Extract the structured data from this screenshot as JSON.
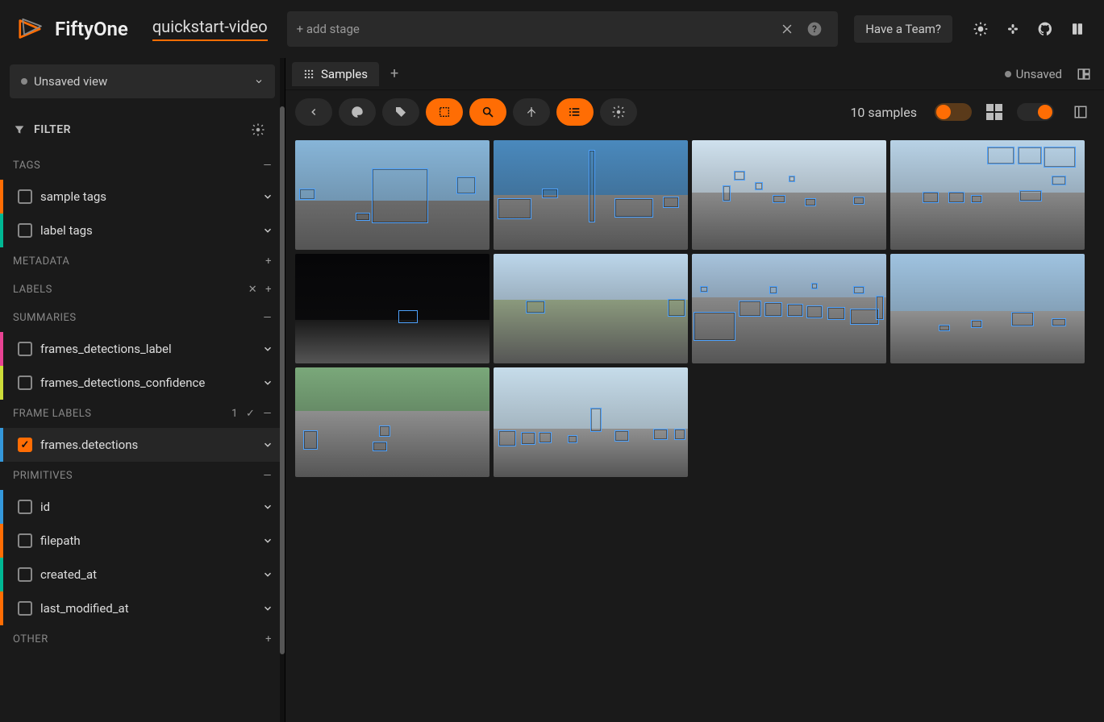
{
  "header": {
    "brand": "FiftyOne",
    "dataset": "quickstart-video",
    "add_stage_placeholder": "+ add stage",
    "team_button": "Have a Team?"
  },
  "sidebar": {
    "view_selector": "Unsaved view",
    "filter_label": "FILTER",
    "sections": [
      {
        "title": "TAGS",
        "action": "minus"
      },
      {
        "title": "METADATA",
        "action": "plus"
      },
      {
        "title": "LABELS",
        "action": "x-plus"
      },
      {
        "title": "SUMMARIES",
        "action": "minus"
      },
      {
        "title": "FRAME LABELS",
        "action": "count-minus",
        "count": "1"
      },
      {
        "title": "PRIMITIVES",
        "action": "minus"
      },
      {
        "title": "OTHER",
        "action": "plus"
      }
    ],
    "items": {
      "tags": [
        {
          "label": "sample tags",
          "color": "orange",
          "checked": false
        },
        {
          "label": "label tags",
          "color": "teal",
          "checked": false
        }
      ],
      "summaries": [
        {
          "label": "frames_detections_label",
          "color": "pink",
          "checked": false
        },
        {
          "label": "frames_detections_confidence",
          "color": "lime",
          "checked": false
        }
      ],
      "frame_labels": [
        {
          "label": "frames.detections",
          "color": "blue",
          "checked": true
        }
      ],
      "primitives": [
        {
          "label": "id",
          "color": "blue",
          "checked": false
        },
        {
          "label": "filepath",
          "color": "orange",
          "checked": false
        },
        {
          "label": "created_at",
          "color": "teal",
          "checked": false
        },
        {
          "label": "last_modified_at",
          "color": "orange",
          "checked": false
        }
      ]
    }
  },
  "content": {
    "tab_label": "Samples",
    "unsaved_label": "Unsaved",
    "samples_count": "10 samples"
  },
  "thumbs": [
    {
      "sky": "#87b5d8",
      "ground": "#6b6b6b",
      "sky_h": 55,
      "boxes": [
        [
          5,
          60,
          20,
          14
        ],
        [
          95,
          35,
          70,
          68
        ],
        [
          200,
          45,
          24,
          22
        ],
        [
          75,
          90,
          18,
          10
        ]
      ]
    },
    {
      "sky": "#4a89bd",
      "ground": "#7a7a7a",
      "sky_h": 50,
      "boxes": [
        [
          5,
          72,
          42,
          26
        ],
        [
          118,
          12,
          8,
          90
        ],
        [
          150,
          72,
          48,
          24
        ],
        [
          60,
          60,
          20,
          12
        ],
        [
          210,
          70,
          20,
          14
        ]
      ]
    },
    {
      "sky": "#cfe1ee",
      "ground": "#8a8a8a",
      "sky_h": 48,
      "boxes": [
        [
          52,
          38,
          14,
          12
        ],
        [
          78,
          52,
          10,
          10
        ],
        [
          100,
          68,
          16,
          10
        ],
        [
          140,
          72,
          14,
          10
        ],
        [
          200,
          70,
          14,
          10
        ],
        [
          38,
          56,
          10,
          20
        ],
        [
          120,
          44,
          8,
          8
        ]
      ]
    },
    {
      "sky": "#b8d2e6",
      "ground": "#888",
      "sky_h": 48,
      "boxes": [
        [
          40,
          64,
          20,
          14
        ],
        [
          72,
          64,
          20,
          14
        ],
        [
          120,
          8,
          34,
          22
        ],
        [
          158,
          8,
          30,
          22
        ],
        [
          190,
          8,
          40,
          26
        ],
        [
          160,
          62,
          28,
          14
        ],
        [
          200,
          44,
          18,
          12
        ],
        [
          100,
          68,
          14,
          10
        ]
      ]
    },
    {
      "sky": "#060608",
      "ground": "#1a1a1a",
      "sky_h": 60,
      "boxes": [
        [
          128,
          70,
          24,
          16
        ]
      ]
    },
    {
      "sky": "#bcd6ea",
      "ground": "#8b9a7d",
      "sky_h": 42,
      "boxes": [
        [
          40,
          58,
          24,
          16
        ],
        [
          216,
          56,
          22,
          22
        ]
      ]
    },
    {
      "sky": "#a7c3dc",
      "ground": "#888",
      "sky_h": 40,
      "boxes": [
        [
          2,
          72,
          52,
          36
        ],
        [
          58,
          58,
          28,
          20
        ],
        [
          90,
          60,
          22,
          18
        ],
        [
          118,
          62,
          20,
          16
        ],
        [
          142,
          64,
          20,
          16
        ],
        [
          168,
          66,
          22,
          16
        ],
        [
          196,
          68,
          36,
          20
        ],
        [
          96,
          40,
          10,
          10
        ],
        [
          148,
          36,
          8,
          8
        ],
        [
          10,
          40,
          10,
          8
        ],
        [
          200,
          40,
          14,
          10
        ],
        [
          228,
          52,
          10,
          30
        ]
      ]
    },
    {
      "sky": "#9fc3e0",
      "ground": "#909090",
      "sky_h": 52,
      "boxes": [
        [
          100,
          82,
          14,
          10
        ],
        [
          150,
          72,
          28,
          18
        ],
        [
          200,
          80,
          18,
          10
        ],
        [
          60,
          88,
          14,
          8
        ]
      ]
    },
    {
      "sky": "#7aa87a",
      "ground": "#8e8e8e",
      "sky_h": 40,
      "boxes": [
        [
          10,
          78,
          18,
          24
        ],
        [
          96,
          92,
          18,
          12
        ],
        [
          104,
          72,
          14,
          14
        ]
      ]
    },
    {
      "sky": "#c6dcea",
      "ground": "#909090",
      "sky_h": 56,
      "boxes": [
        [
          6,
          78,
          22,
          20
        ],
        [
          34,
          80,
          18,
          16
        ],
        [
          56,
          80,
          16,
          14
        ],
        [
          150,
          78,
          18,
          14
        ],
        [
          198,
          76,
          18,
          14
        ],
        [
          224,
          76,
          14,
          14
        ],
        [
          92,
          84,
          12,
          10
        ],
        [
          120,
          50,
          14,
          30
        ]
      ]
    }
  ]
}
